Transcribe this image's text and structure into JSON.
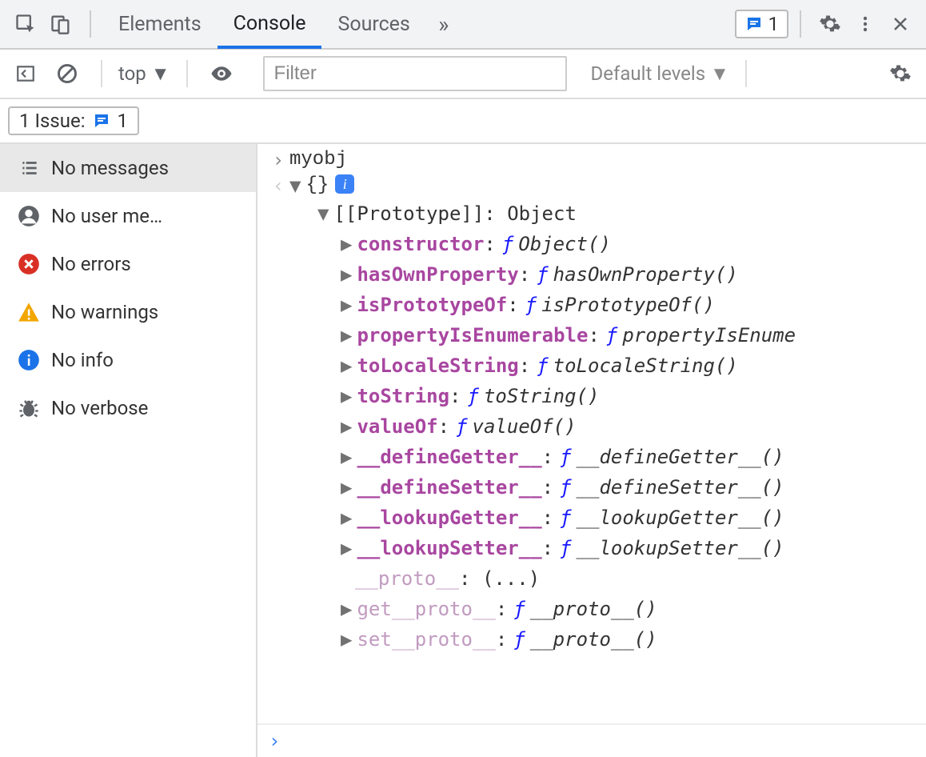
{
  "tabs": {
    "elements": "Elements",
    "console": "Console",
    "sources": "Sources"
  },
  "toolbar": {
    "context": "top",
    "filter_placeholder": "Filter",
    "levels": "Default levels"
  },
  "issues": {
    "label": "1 Issue:",
    "count": "1",
    "top_count": "1"
  },
  "sidebar": {
    "items": [
      {
        "label": "No messages"
      },
      {
        "label": "No user me…"
      },
      {
        "label": "No errors"
      },
      {
        "label": "No warnings"
      },
      {
        "label": "No info"
      },
      {
        "label": "No verbose"
      }
    ]
  },
  "console": {
    "input": "myobj",
    "root": "{}",
    "proto_label": "[[Prototype]]",
    "proto_value": "Object",
    "props": [
      {
        "k": "constructor",
        "f": "Object()",
        "dim": false
      },
      {
        "k": "hasOwnProperty",
        "f": "hasOwnProperty()",
        "dim": false
      },
      {
        "k": "isPrototypeOf",
        "f": "isPrototypeOf()",
        "dim": false
      },
      {
        "k": "propertyIsEnumerable",
        "f": "propertyIsEnume",
        "dim": false
      },
      {
        "k": "toLocaleString",
        "f": "toLocaleString()",
        "dim": false
      },
      {
        "k": "toString",
        "f": "toString()",
        "dim": false
      },
      {
        "k": "valueOf",
        "f": "valueOf()",
        "dim": false
      },
      {
        "k": "__defineGetter__",
        "f": "__defineGetter__()",
        "dim": false
      },
      {
        "k": "__defineSetter__",
        "f": "__defineSetter__()",
        "dim": false
      },
      {
        "k": "__lookupGetter__",
        "f": "__lookupGetter__()",
        "dim": false
      },
      {
        "k": "__lookupSetter__",
        "f": "__lookupSetter__()",
        "dim": false
      }
    ],
    "proto_ellipsis": {
      "k": "__proto__",
      "v": "(...)"
    },
    "accessors": [
      {
        "prefix": "get ",
        "k": "__proto__",
        "f": "__proto__()"
      },
      {
        "prefix": "set ",
        "k": "__proto__",
        "f": "__proto__()"
      }
    ]
  }
}
